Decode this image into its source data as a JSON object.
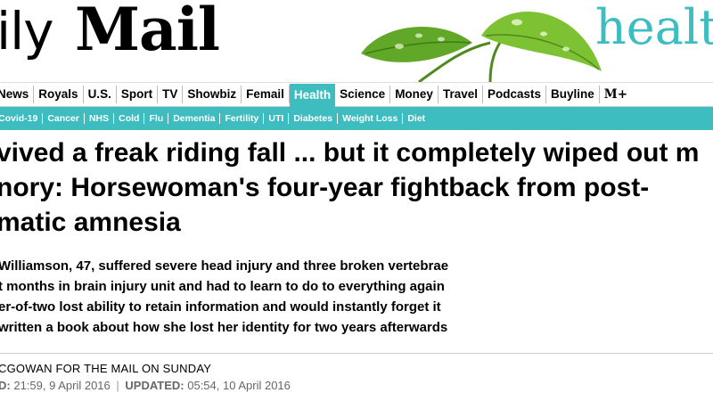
{
  "masthead": {
    "logo_daily": "ily",
    "logo_mail": "Mail",
    "section_word": "healt",
    "brand_color": "#3dbdc0"
  },
  "nav": {
    "items": [
      {
        "label": "News"
      },
      {
        "label": "Royals"
      },
      {
        "label": "U.S."
      },
      {
        "label": "Sport"
      },
      {
        "label": "TV"
      },
      {
        "label": "Showbiz"
      },
      {
        "label": "Femail"
      },
      {
        "label": "Health",
        "active": true
      },
      {
        "label": "Science"
      },
      {
        "label": "Money"
      },
      {
        "label": "Travel"
      },
      {
        "label": "Podcasts"
      },
      {
        "label": "Buyline"
      },
      {
        "label": "M+"
      }
    ]
  },
  "subnav": {
    "items": [
      {
        "label": "Covid-19"
      },
      {
        "label": "Cancer"
      },
      {
        "label": "NHS"
      },
      {
        "label": "Cold"
      },
      {
        "label": "Flu"
      },
      {
        "label": "Dementia"
      },
      {
        "label": "Fertility"
      },
      {
        "label": "UTI"
      },
      {
        "label": "Diabetes"
      },
      {
        "label": "Weight Loss"
      },
      {
        "label": "Diet"
      }
    ]
  },
  "article": {
    "headline_lines": [
      "vived a freak riding fall ... but it completely wiped out m",
      "nory: Horsewoman's four-year fightback from post-",
      "matic amnesia"
    ],
    "bullets": [
      "Williamson, 47, suffered severe head injury and three broken vertebrae",
      "t months in brain injury unit and had to learn to do to everything again",
      "er-of-two lost ability to retain information and would instantly forget it",
      "written a book about how she lost her identity for two years afterwards"
    ],
    "byline": "CGOWAN FOR THE MAIL ON SUNDAY",
    "published_label": "D:",
    "published_value": "21:59, 9 April 2016",
    "separator": "|",
    "updated_label": "UPDATED:",
    "updated_value": "05:54, 10 April 2016"
  }
}
